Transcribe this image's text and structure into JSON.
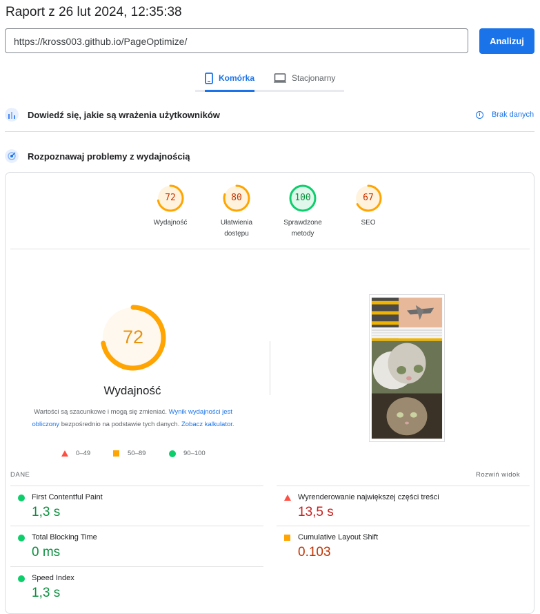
{
  "report_title": "Raport z 26 lut 2024, 12:35:38",
  "url_input": {
    "value": "https://kross003.github.io/PageOptimize/"
  },
  "analyze_button": "Analizuj",
  "tabs": [
    {
      "label": "Komórka",
      "active": true,
      "icon": "smartphone-icon"
    },
    {
      "label": "Stacjonarny",
      "active": false,
      "icon": "desktop-icon"
    }
  ],
  "field_section": {
    "title": "Dowiedź się, jakie są wrażenia użytkowników",
    "status": "Brak danych"
  },
  "lab_section": {
    "title": "Rozpoznawaj problemy z wydajnością"
  },
  "scores": [
    {
      "value": "72",
      "label_line1": "Wydajność",
      "label_line2": "",
      "color": "#ffa400",
      "fraction": 0.72
    },
    {
      "value": "80",
      "label_line1": "Ułatwienia",
      "label_line2": "dostępu",
      "color": "#ffa400",
      "fraction": 0.8
    },
    {
      "value": "100",
      "label_line1": "Sprawdzone",
      "label_line2": "metody",
      "color": "#0cce6b",
      "fraction": 1.0
    },
    {
      "value": "67",
      "label_line1": "SEO",
      "label_line2": "",
      "color": "#ffa400",
      "fraction": 0.67
    }
  ],
  "main_score": {
    "value": "72",
    "label": "Wydajność",
    "fraction": 0.72
  },
  "note": {
    "text1": "Wartości są szacunkowe i mogą się zmieniać.",
    "link1": "Wynik wydajności jest obliczony",
    "text2": "bezpośrednio na podstawie tych danych.",
    "link2": "Zobacz kalkulator."
  },
  "legend": [
    {
      "label": "0–49",
      "shape": "triangle",
      "color": "#ff4e42"
    },
    {
      "label": "50–89",
      "shape": "square",
      "color": "#ffa400"
    },
    {
      "label": "90–100",
      "shape": "circle",
      "color": "#0cce6b"
    }
  ],
  "metrics_header": {
    "left": "DANE",
    "right": "Rozwiń widok"
  },
  "metrics": [
    {
      "name": "First Contentful Paint",
      "value": "1,3 s",
      "status": "good"
    },
    {
      "name": "Wyrenderowanie największej części treści",
      "value": "13,5 s",
      "status": "poor"
    },
    {
      "name": "Total Blocking Time",
      "value": "0 ms",
      "status": "good"
    },
    {
      "name": "Cumulative Layout Shift",
      "value": "0.103",
      "status": "average"
    },
    {
      "name": "Speed Index",
      "value": "1,3 s",
      "status": "good"
    }
  ]
}
